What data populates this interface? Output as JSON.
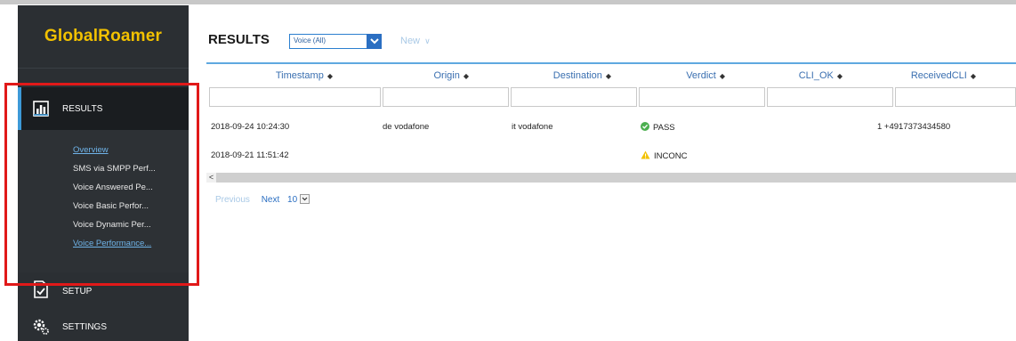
{
  "app": {
    "brand": "GlobalRoamer"
  },
  "sidebar": {
    "results_label": "RESULTS",
    "sub_items": [
      "Overview",
      "SMS via SMPP Perf...",
      "Voice Answered Pe...",
      "Voice Basic Perfor...",
      "Voice Dynamic Per...",
      "Voice Performance..."
    ],
    "setup_label": "SETUP",
    "settings_label": "SETTINGS"
  },
  "header": {
    "title": "RESULTS",
    "filter_value": "Voice (All)",
    "new_label": "New"
  },
  "table": {
    "columns": [
      "Timestamp",
      "Origin",
      "Destination",
      "Verdict",
      "CLI_OK",
      "ReceivedCLI"
    ],
    "rows": [
      {
        "timestamp": "2018-09-24 10:24:30",
        "origin": "de vodafone",
        "destination": "it vodafone",
        "verdict": "PASS",
        "cli_ok": "",
        "received_cli": "1 +4917373434580"
      },
      {
        "timestamp": "2018-09-21 11:51:42",
        "origin": "",
        "destination": "",
        "verdict": "INCONC",
        "cli_ok": "",
        "received_cli": ""
      }
    ]
  },
  "pager": {
    "previous": "Previous",
    "next": "Next",
    "page_size": "10"
  },
  "colors": {
    "accent": "#3d9ad8",
    "brand": "#f2c100",
    "highlight_box": "#e11919",
    "pass": "#4caf50",
    "inconc": "#f2c100"
  }
}
